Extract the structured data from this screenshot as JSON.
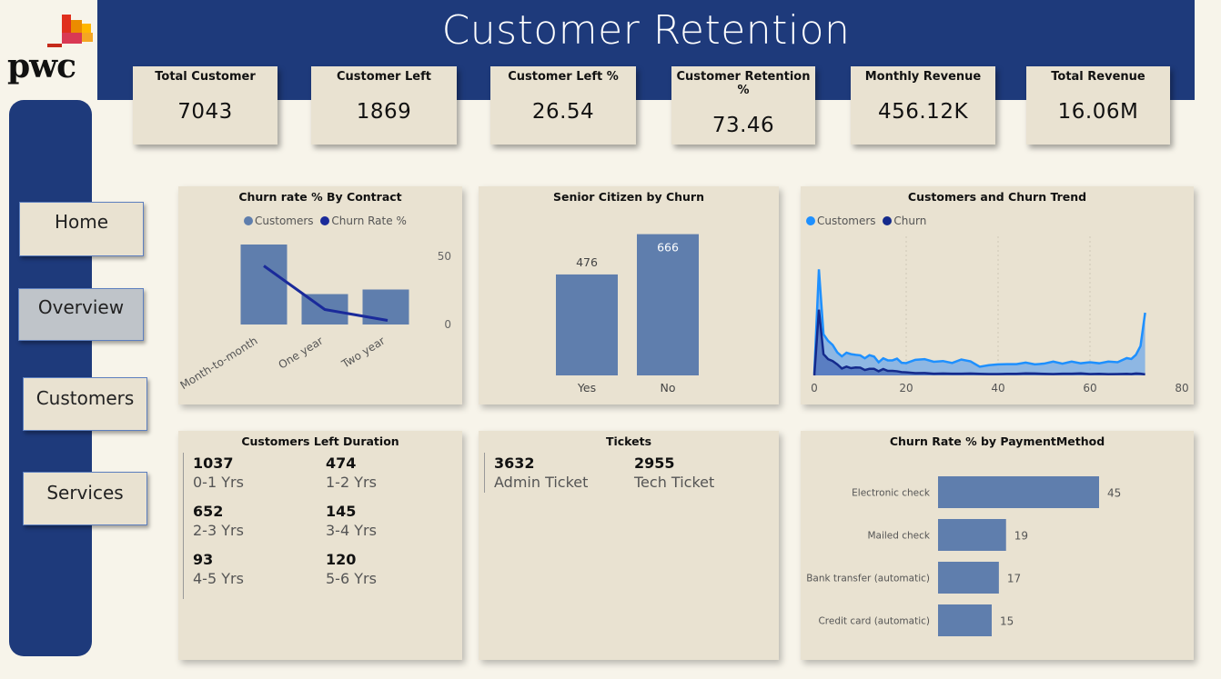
{
  "header": {
    "title": "Customer Retention"
  },
  "logo": {
    "text": "pwc"
  },
  "kpis": [
    {
      "label": "Total Customer",
      "value": "7043"
    },
    {
      "label": "Customer Left",
      "value": "1869"
    },
    {
      "label": "Customer Left %",
      "value": "26.54"
    },
    {
      "label": "Customer Retention %",
      "value": "73.46"
    },
    {
      "label": "Monthly Revenue",
      "value": "456.12K"
    },
    {
      "label": "Total Revenue",
      "value": "16.06M"
    }
  ],
  "nav": {
    "home": "Home",
    "overview": "Overview",
    "customers": "Customers",
    "services": "Services",
    "active": "Overview"
  },
  "contract_chart": {
    "title": "Churn rate % By Contract",
    "legend_customers": "Customers",
    "legend_churn": "Churn Rate %",
    "axis_top": "50",
    "axis_bottom": "0"
  },
  "senior_chart": {
    "title": "Senior Citizen by Churn"
  },
  "trend_chart": {
    "title": "Customers and Churn Trend",
    "legend_customers": "Customers",
    "legend_churn": "Churn"
  },
  "duration": {
    "title": "Customers Left Duration",
    "items": [
      {
        "value": "1037",
        "label": "0-1 Yrs"
      },
      {
        "value": "474",
        "label": "1-2 Yrs"
      },
      {
        "value": "652",
        "label": "2-3 Yrs"
      },
      {
        "value": "145",
        "label": "3-4 Yrs"
      },
      {
        "value": "93",
        "label": "4-5 Yrs"
      },
      {
        "value": "120",
        "label": "5-6 Yrs"
      }
    ]
  },
  "tickets": {
    "title": "Tickets",
    "items": [
      {
        "value": "3632",
        "label": "Admin Ticket"
      },
      {
        "value": "2955",
        "label": "Tech Ticket"
      }
    ]
  },
  "payment_chart": {
    "title": "Churn Rate % by PaymentMethod"
  },
  "colors": {
    "navy": "#1e3a7b",
    "card": "#e9e2d1",
    "bar": "#5f7ead",
    "churn_line": "#1a2a9a",
    "trend_customers": "#1e90ff",
    "trend_churn": "#142a8c"
  },
  "chart_data": [
    {
      "type": "bar",
      "title": "Churn rate % By Contract",
      "categories": [
        "Month-to-month",
        "One year",
        "Two year"
      ],
      "series": [
        {
          "name": "Customers",
          "type": "bar",
          "values": [
            3875,
            1473,
            1695
          ]
        },
        {
          "name": "Churn Rate %",
          "type": "line",
          "values": [
            43,
            11,
            3
          ]
        }
      ],
      "secondary_axis_ticks": [
        "50",
        "0"
      ],
      "secondary_ylim": [
        0,
        50
      ],
      "legend": "top"
    },
    {
      "type": "bar",
      "title": "Senior Citizen by Churn",
      "categories": [
        "Yes",
        "No"
      ],
      "values": [
        476,
        666
      ],
      "ylim": [
        0,
        720
      ]
    },
    {
      "type": "area",
      "title": "Customers and Churn Trend",
      "x_ticks": [
        "0",
        "20",
        "40",
        "60",
        "80"
      ],
      "xlim": [
        0,
        80
      ],
      "ylim": [
        0,
        620
      ],
      "series": [
        {
          "name": "Customers",
          "x": [
            0,
            1,
            2,
            3,
            4,
            5,
            6,
            7,
            8,
            9,
            10,
            11,
            12,
            13,
            14,
            15,
            16,
            17,
            18,
            19,
            20,
            22,
            24,
            26,
            28,
            30,
            32,
            34,
            36,
            38,
            40,
            42,
            44,
            46,
            48,
            50,
            52,
            54,
            56,
            58,
            60,
            62,
            64,
            66,
            68,
            69,
            70,
            71,
            72
          ],
          "y": [
            11,
            613,
            238,
            200,
            176,
            133,
            110,
            131,
            123,
            119,
            116,
            99,
            117,
            109,
            76,
            99,
            87,
            87,
            97,
            73,
            71,
            90,
            94,
            79,
            83,
            72,
            92,
            81,
            50,
            59,
            64,
            65,
            65,
            74,
            64,
            68,
            80,
            68,
            80,
            70,
            76,
            70,
            80,
            76,
            100,
            95,
            119,
            170,
            362
          ]
        },
        {
          "name": "Churn",
          "x": [
            0,
            1,
            2,
            3,
            4,
            5,
            6,
            7,
            8,
            9,
            10,
            11,
            12,
            13,
            14,
            15,
            16,
            17,
            18,
            19,
            20,
            22,
            24,
            26,
            28,
            30,
            32,
            34,
            36,
            38,
            40,
            42,
            44,
            46,
            48,
            50,
            52,
            54,
            56,
            58,
            60,
            62,
            64,
            66,
            68,
            69,
            70,
            71,
            72
          ],
          "y": [
            0,
            380,
            123,
            94,
            83,
            64,
            40,
            51,
            42,
            46,
            45,
            31,
            38,
            38,
            24,
            37,
            26,
            26,
            24,
            19,
            18,
            13,
            14,
            10,
            11,
            10,
            10,
            11,
            9,
            8,
            8,
            9,
            9,
            12,
            11,
            9,
            8,
            10,
            10,
            12,
            8,
            9,
            7,
            8,
            9,
            8,
            11,
            10,
            6
          ]
        }
      ],
      "legend": "top-left"
    },
    {
      "type": "bar",
      "orientation": "horizontal",
      "title": "Churn Rate % by PaymentMethod",
      "categories": [
        "Electronic check",
        "Mailed check",
        "Bank transfer (automatic)",
        "Credit card (automatic)"
      ],
      "values": [
        45,
        19,
        17,
        15
      ],
      "xlim": [
        0,
        50
      ]
    }
  ]
}
